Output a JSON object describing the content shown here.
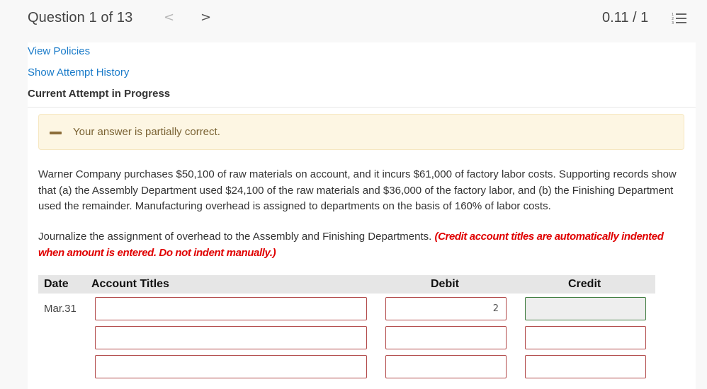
{
  "header": {
    "question_label": "Question 1 of 13",
    "prev_icon": "chevron-left-icon",
    "next_icon": "chevron-right-icon",
    "prev_glyph": "<",
    "next_glyph": ">",
    "score": "0.11 / 1",
    "list_icon": "numbered-list-icon"
  },
  "links": {
    "view_policies": "View Policies",
    "show_attempt_history": "Show Attempt History"
  },
  "attempt_status": "Current Attempt in Progress",
  "feedback": {
    "icon": "partial-dash-icon",
    "text": "Your answer is partially correct."
  },
  "question": {
    "text": "Warner Company purchases $50,100 of raw materials on account, and it incurs $61,000 of factory labor costs. Supporting records show that (a) the Assembly Department used $24,100 of the raw materials and $36,000 of the factory labor, and (b) the Finishing Department used the remainder. Manufacturing overhead is assigned to departments on the basis of 160% of labor costs.",
    "instruction": "Journalize the assignment of overhead to the Assembly and Finishing Departments.",
    "instruction_note": "(Credit account titles are automatically indented when amount is entered. Do not indent manually.)"
  },
  "journal": {
    "columns": [
      "Date",
      "Account Titles",
      "Debit",
      "Credit"
    ],
    "rows": [
      {
        "date": "Mar.31",
        "account": "",
        "debit": "2",
        "credit": "",
        "account_state": "incorrect",
        "debit_state": "incorrect",
        "credit_state": "correct"
      },
      {
        "date": "",
        "account": "",
        "debit": "",
        "credit": "",
        "account_state": "incorrect",
        "debit_state": "incorrect",
        "credit_state": "incorrect"
      },
      {
        "date": "",
        "account": "",
        "debit": "",
        "credit": "",
        "account_state": "incorrect",
        "debit_state": "incorrect",
        "credit_state": "incorrect"
      }
    ]
  },
  "colors": {
    "link": "#1a7bc9",
    "incorrect_border": "#b24a4a",
    "correct_border": "#3f7c3f",
    "feedback_bg": "#fdf6e3",
    "instruction_note": "#e00000"
  }
}
